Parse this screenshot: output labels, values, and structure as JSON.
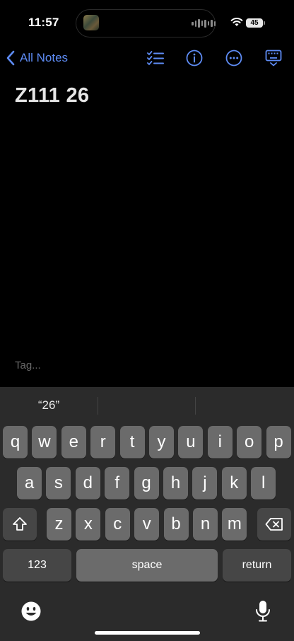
{
  "status_bar": {
    "time": "11:57",
    "battery_level": "45"
  },
  "nav": {
    "back_label": "All Notes"
  },
  "note": {
    "title": "Z111 26",
    "tag_placeholder": "Tag..."
  },
  "keyboard": {
    "prediction": "“26”",
    "row1": [
      "q",
      "w",
      "e",
      "r",
      "t",
      "y",
      "u",
      "i",
      "o",
      "p"
    ],
    "row2": [
      "a",
      "s",
      "d",
      "f",
      "g",
      "h",
      "j",
      "k",
      "l"
    ],
    "row3": [
      "z",
      "x",
      "c",
      "v",
      "b",
      "n",
      "m"
    ],
    "numbers_label": "123",
    "space_label": "space",
    "return_label": "return"
  },
  "colors": {
    "accent": "#5e8cf5",
    "keyboard_bg": "#2b2b2b",
    "key": "#6b6b6b",
    "function_key": "#464646"
  }
}
